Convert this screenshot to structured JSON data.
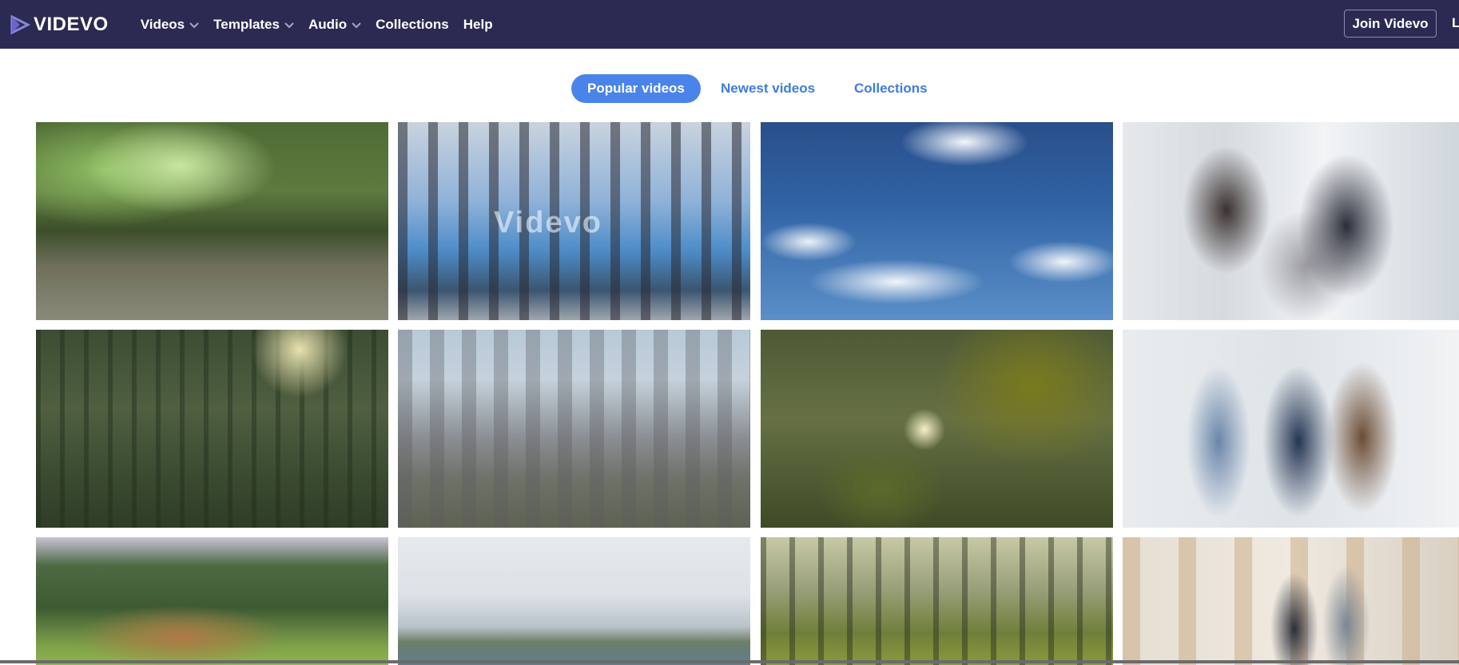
{
  "brand": {
    "name": "VIDEVO",
    "logo_icon": "play-triangle-icon"
  },
  "nav": {
    "items": [
      {
        "label": "Videos",
        "dropdown": true
      },
      {
        "label": "Templates",
        "dropdown": true
      },
      {
        "label": "Audio",
        "dropdown": true
      },
      {
        "label": "Collections",
        "dropdown": false
      },
      {
        "label": "Help",
        "dropdown": false
      }
    ],
    "join_label": "Join Videvo",
    "login_partial": "L"
  },
  "tabs": [
    {
      "label": "Popular videos",
      "active": true
    },
    {
      "label": "Newest videos",
      "active": false
    },
    {
      "label": "Collections",
      "active": false
    }
  ],
  "thumbnails": [
    {
      "scene": "forest-path"
    },
    {
      "scene": "factory-machinery",
      "watermark": "Videvo"
    },
    {
      "scene": "blue-sky-clouds"
    },
    {
      "scene": "office-team-laptop"
    },
    {
      "scene": "forest-sunlight"
    },
    {
      "scene": "city-skyline"
    },
    {
      "scene": "sunlit-leaves"
    },
    {
      "scene": "office-team-standing"
    },
    {
      "scene": "lions-grassland"
    },
    {
      "scene": "misty-coast"
    },
    {
      "scene": "forest-meadow"
    },
    {
      "scene": "office-walking"
    }
  ],
  "colors": {
    "header_bg": "#2b2a52",
    "accent": "#4a84ea",
    "tab_text": "#3f7be0"
  }
}
